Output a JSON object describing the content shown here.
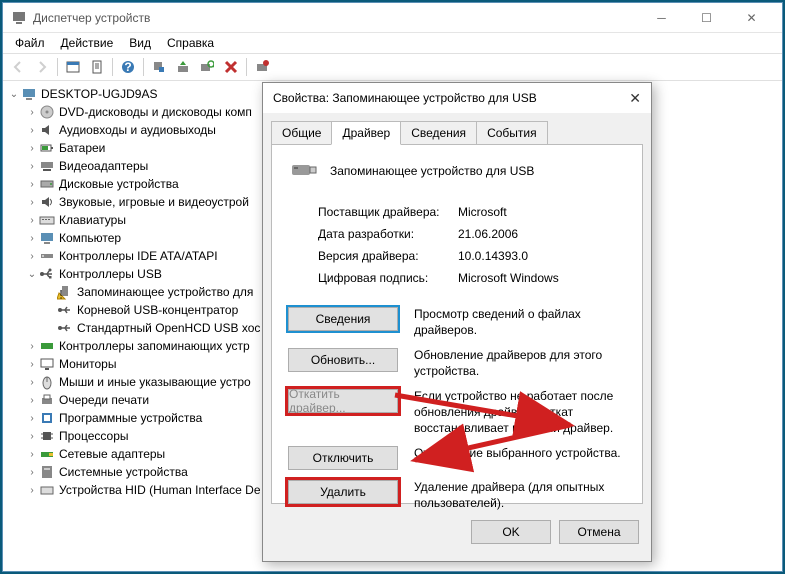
{
  "window": {
    "title": "Диспетчер устройств"
  },
  "menu": {
    "file": "Файл",
    "action": "Действие",
    "view": "Вид",
    "help": "Справка"
  },
  "tree": {
    "root": "DESKTOP-UGJD9AS",
    "items": [
      "DVD-дисководы и дисководы комп",
      "Аудиовходы и аудиовыходы",
      "Батареи",
      "Видеоадаптеры",
      "Дисковые устройства",
      "Звуковые, игровые и видеоустрой",
      "Клавиатуры",
      "Компьютер",
      "Контроллеры IDE ATA/ATAPI"
    ],
    "usb_label": "Контроллеры USB",
    "usb_children": [
      "Запоминающее устройство для",
      "Корневой USB-концентратор",
      "Стандартный OpenHCD USB хос"
    ],
    "items2": [
      "Контроллеры запоминающих устр",
      "Мониторы",
      "Мыши и иные указывающие устро",
      "Очереди печати",
      "Программные устройства",
      "Процессоры",
      "Сетевые адаптеры",
      "Системные устройства",
      "Устройства HID (Human Interface De"
    ]
  },
  "dialog": {
    "title": "Свойства: Запоминающее устройство для USB",
    "tabs": {
      "general": "Общие",
      "driver": "Драйвер",
      "details": "Сведения",
      "events": "События"
    },
    "device_name": "Запоминающее устройство для USB",
    "info": {
      "provider_k": "Поставщик драйвера:",
      "provider_v": "Microsoft",
      "date_k": "Дата разработки:",
      "date_v": "21.06.2006",
      "version_k": "Версия драйвера:",
      "version_v": "10.0.14393.0",
      "signer_k": "Цифровая подпись:",
      "signer_v": "Microsoft Windows"
    },
    "actions": {
      "details_btn": "Сведения",
      "details_desc": "Просмотр сведений о файлах драйверов.",
      "update_btn": "Обновить...",
      "update_desc": "Обновление драйверов для этого устройства.",
      "rollback_btn": "Откатить драйвер...",
      "rollback_desc": "Если устройство не работает после обновления драйвера, откат восстанавливает прежний драйвер.",
      "disable_btn": "Отключить",
      "disable_desc": "Отключение выбранного устройства.",
      "uninstall_btn": "Удалить",
      "uninstall_desc": "Удаление драйвера (для опытных пользователей)."
    },
    "footer": {
      "ok": "OK",
      "cancel": "Отмена"
    }
  }
}
